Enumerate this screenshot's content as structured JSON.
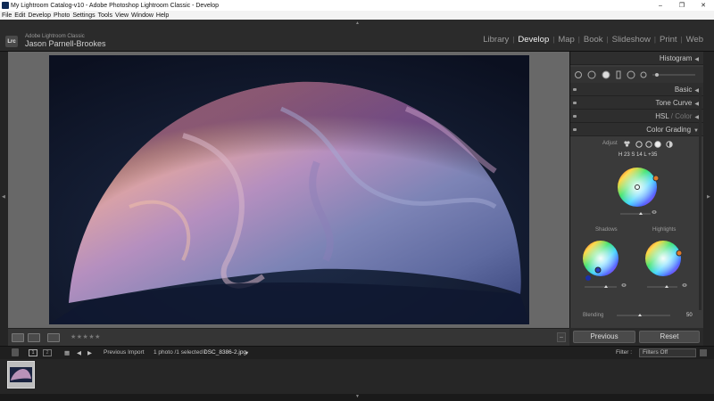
{
  "window": {
    "title": "My Lightroom Catalog-v10 - Adobe Photoshop Lightroom Classic - Develop",
    "controls": [
      "–",
      "❐",
      "✕"
    ]
  },
  "menu": [
    "File",
    "Edit",
    "Develop",
    "Photo",
    "Settings",
    "Tools",
    "View",
    "Window",
    "Help"
  ],
  "identity": {
    "logo": "Lrc",
    "product": "Adobe Lightroom Classic",
    "user": "Jason Parnell-Brookes"
  },
  "modules": [
    {
      "label": "Library",
      "active": false
    },
    {
      "label": "Develop",
      "active": true
    },
    {
      "label": "Map",
      "active": false
    },
    {
      "label": "Book",
      "active": false
    },
    {
      "label": "Slideshow",
      "active": false
    },
    {
      "label": "Print",
      "active": false
    },
    {
      "label": "Web",
      "active": false
    }
  ],
  "panels": {
    "histogram": "Histogram",
    "basic": "Basic",
    "tone_curve": "Tone Curve",
    "hsl": "HSL",
    "hsl_sep": "/",
    "color": "Color",
    "color_grading": "Color Grading"
  },
  "color_grading": {
    "adjust_label": "Adjust",
    "readout": "H 23 S 14 L +35",
    "shadows_label": "Shadows",
    "highlights_label": "Highlights",
    "blending_label": "Blending",
    "blending_value": "50"
  },
  "buttons": {
    "previous": "Previous",
    "reset": "Reset"
  },
  "filmstrip": {
    "page1": "1",
    "page2": "2",
    "source": "Previous Import",
    "status": "1 photo /1 selected /",
    "filename": "DSC_8386-2.jpg",
    "filename_suffix": "▾",
    "filter_label": "Filter :",
    "filter_value": "Filters Off"
  },
  "toolbar": {
    "stars": "★★★★★"
  },
  "colors": {
    "accent_orange": "#e07a2a",
    "active_text": "#f0f0f0"
  }
}
